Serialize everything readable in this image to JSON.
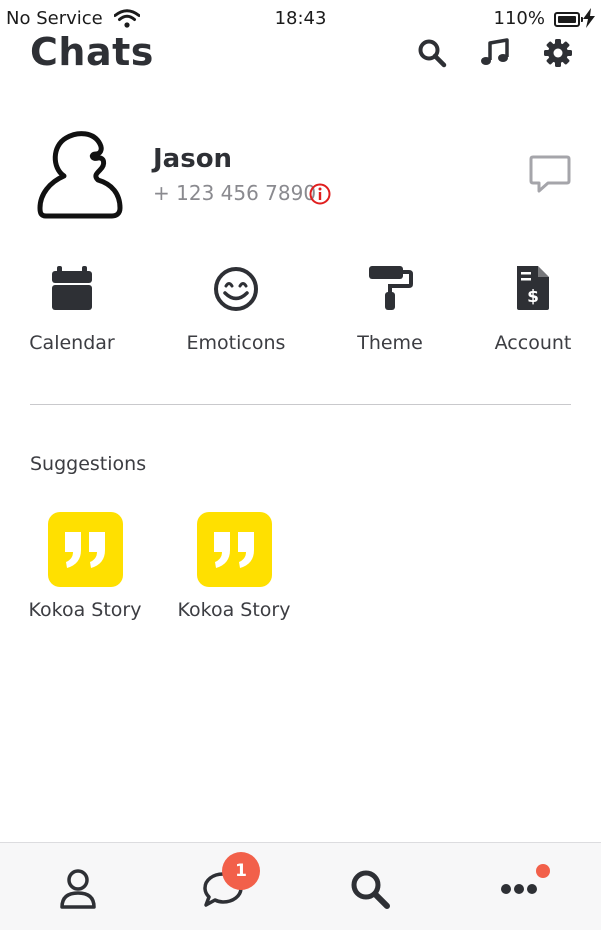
{
  "status_bar": {
    "carrier": "No Service",
    "time": "18:43",
    "battery": "110%"
  },
  "header": {
    "title": "Chats",
    "icons": [
      "search-icon",
      "music-note-icon",
      "gear-icon"
    ]
  },
  "profile": {
    "name": "Jason",
    "phone": "+ 123 456 7890",
    "info_icon": "info-circle-icon",
    "action_icon": "chat-bubble-icon",
    "info_color": "#e01e1e"
  },
  "quick_actions": [
    {
      "label": "Calendar",
      "icon": "calendar-icon"
    },
    {
      "label": "Emoticons",
      "icon": "smiley-icon"
    },
    {
      "label": "Theme",
      "icon": "paint-roller-icon"
    },
    {
      "label": "Account",
      "icon": "invoice-dollar-icon"
    }
  ],
  "suggestions": {
    "title": "Suggestions",
    "items": [
      {
        "label": "Kokoa Story",
        "icon": "quote-icon"
      },
      {
        "label": "Kokoa Story",
        "icon": "quote-icon"
      }
    ],
    "tile_color": "#ffe000"
  },
  "tab_bar": {
    "tabs": [
      {
        "icon": "person-icon"
      },
      {
        "icon": "chat-icon",
        "badge": "1"
      },
      {
        "icon": "search-icon"
      },
      {
        "icon": "more-dots-icon",
        "dot": true
      }
    ],
    "badge_color": "#f2604a"
  }
}
